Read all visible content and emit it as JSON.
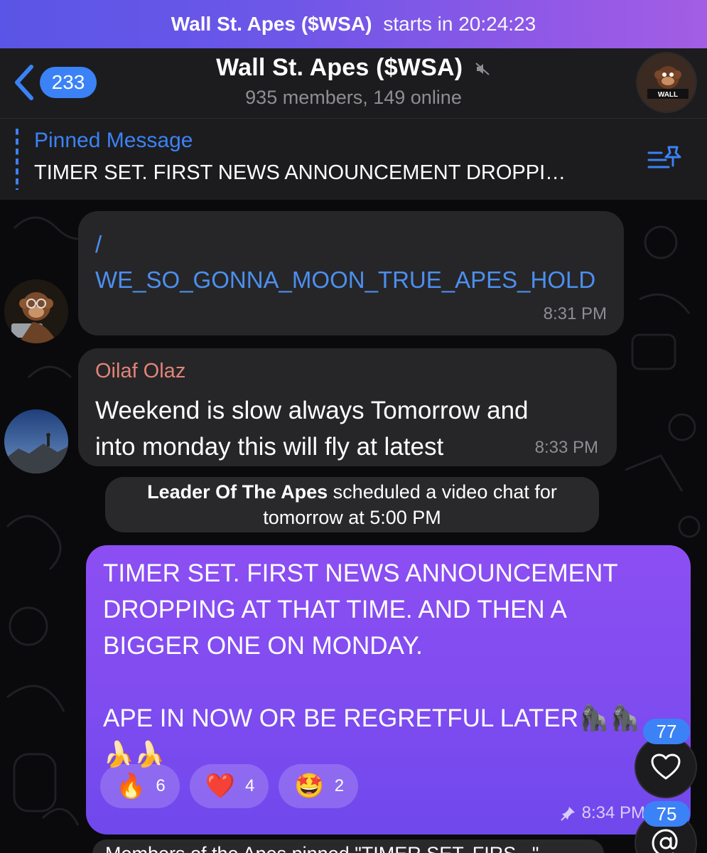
{
  "banner": {
    "chat_name": "Wall St. Apes ($WSA)",
    "starts_text": "starts in 20:24:23"
  },
  "header": {
    "back_count": "233",
    "title": "Wall St. Apes ($WSA)",
    "subtitle": "935 members, 149 online",
    "avatar_label": "WALL"
  },
  "pinned": {
    "title": "Pinned Message",
    "text": "TIMER SET. FIRST NEWS ANNOUNCEMENT DROPPI…"
  },
  "messages": [
    {
      "text": "/\nWE_SO_GONNA_MOON_TRUE_APES_HOLD",
      "time": "8:31 PM"
    },
    {
      "sender": "Oilaf Olaz",
      "text": "Weekend is slow always    Tomorrow and\ninto monday this will fly at latest",
      "time": "8:33 PM"
    }
  ],
  "service": {
    "name": "Leader Of The Apes",
    "text_1": " scheduled a video chat for",
    "text_2": "tomorrow at 5:00 PM"
  },
  "outgoing": {
    "text": "TIMER SET. FIRST NEWS ANNOUNCEMENT\nDROPPING AT THAT TIME. AND THEN A\nBIGGER ONE ON MONDAY.\n\nAPE IN NOW OR BE REGRETFUL LATER🦍🦍\n🍌🍌",
    "time": "8:34 PM",
    "reactions": [
      {
        "emoji": "🔥",
        "count": "6"
      },
      {
        "emoji": "❤️",
        "count": "4"
      },
      {
        "emoji": "🤩",
        "count": "2"
      }
    ]
  },
  "floating": {
    "reactions_badge": "77",
    "mentions_badge": "75"
  },
  "last_message_preview": "Members of the Apes pinned \"TIMER SET. FIRS...\"",
  "colors": {
    "accent": "#3b82f6",
    "sender_name": "#e3837a",
    "outgoing_bubble": "#8c4ef2",
    "incoming_bubble": "#262628"
  },
  "icons": [
    "chevron-left-icon",
    "mute-icon",
    "list-pin-icon",
    "heart-icon",
    "at-sign-icon",
    "pin-icon"
  ]
}
